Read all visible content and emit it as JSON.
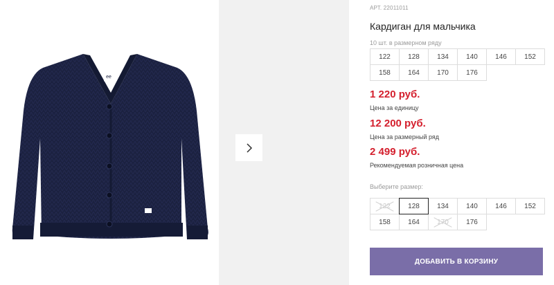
{
  "product": {
    "art": "АРТ. 22011011",
    "title": "Кардиган для мальчика",
    "row_note": "10 шт. в размерном ряду",
    "row_sizes": [
      "122",
      "128",
      "134",
      "140",
      "146",
      "152",
      "158",
      "164",
      "170",
      "176"
    ],
    "prices": [
      {
        "value": "1 220 руб.",
        "note": "Цена за единицу"
      },
      {
        "value": "12 200 руб.",
        "note": "Цена за размерный ряд"
      },
      {
        "value": "2 499 руб.",
        "note": "Рекомендуемая розничная цена"
      }
    ],
    "choose_label": "Выберите размер:",
    "choose_sizes": [
      {
        "label": "122",
        "state": "disabled"
      },
      {
        "label": "128",
        "state": "selected"
      },
      {
        "label": "134",
        "state": "available"
      },
      {
        "label": "140",
        "state": "available"
      },
      {
        "label": "146",
        "state": "available"
      },
      {
        "label": "152",
        "state": "available"
      },
      {
        "label": "158",
        "state": "available"
      },
      {
        "label": "164",
        "state": "available"
      },
      {
        "label": "170",
        "state": "disabled"
      },
      {
        "label": "176",
        "state": "available"
      }
    ],
    "cart_button": "ДОБАВИТЬ В КОРЗИНУ"
  },
  "gallery": {
    "next_icon": "chevron-right-icon",
    "logo_text": "ee"
  },
  "colors": {
    "price": "#d4202e",
    "button": "#7a6ea8",
    "cardigan": "#1b2140"
  }
}
